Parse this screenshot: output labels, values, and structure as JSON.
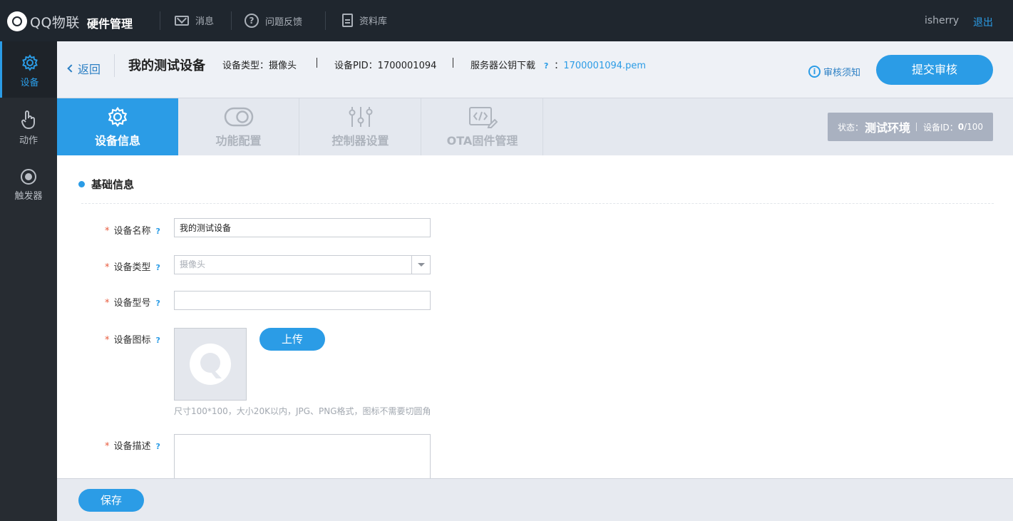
{
  "topbar": {
    "brand": "QQ物联",
    "app_title": "硬件管理",
    "nav": [
      {
        "label": "消息",
        "icon": "mail-icon"
      },
      {
        "label": "问题反馈",
        "icon": "help-circle-icon"
      },
      {
        "label": "资料库",
        "icon": "document-icon"
      }
    ],
    "user": "isherry",
    "logout": "退出"
  },
  "sidebar": {
    "items": [
      {
        "label": "设备",
        "icon": "gear-icon",
        "active": true
      },
      {
        "label": "动作",
        "icon": "hand-pointer-icon",
        "active": false
      },
      {
        "label": "触发器",
        "icon": "radio-target-icon",
        "active": false
      }
    ]
  },
  "header": {
    "back": "返回",
    "device_name": "我的测试设备",
    "type_text": "设备类型：摄像头",
    "pid_text": "设备PID：1700001094",
    "key_label": "服务器公钥下载",
    "key_qmark": "?",
    "key_colon": "：",
    "key_file": "1700001094.pem",
    "audit_note": "审核须知",
    "submit": "提交审核"
  },
  "tabs": [
    {
      "label": "设备信息",
      "icon": "gear-icon",
      "active": true
    },
    {
      "label": "功能配置",
      "icon": "toggle-icon",
      "active": false
    },
    {
      "label": "控制器设置",
      "icon": "sliders-icon",
      "active": false
    },
    {
      "label": "OTA固件管理",
      "icon": "code-edit-icon",
      "active": false
    }
  ],
  "status": {
    "label": "状态：",
    "value": "测试环境",
    "device_id_label": "设备ID：",
    "device_id_value": "0",
    "device_id_total": "/100"
  },
  "form": {
    "section_title": "基础信息",
    "required_mark": "*",
    "qmark": "?",
    "name_label": "设备名称",
    "name_value": "我的测试设备",
    "type_label": "设备类型",
    "type_value": "摄像头",
    "model_label": "设备型号",
    "model_value": "",
    "icon_label": "设备图标",
    "upload": "上传",
    "icon_hint": "尺寸100*100，大小20K以内，JPG、PNG格式，图标不需要切圆角",
    "desc_label": "设备描述"
  },
  "footer": {
    "save": "保存"
  },
  "colors": {
    "accent": "#2b9ce6",
    "topbar_bg": "#1f262e",
    "sidebar_bg": "#272c32",
    "required": "#e85a3c"
  }
}
